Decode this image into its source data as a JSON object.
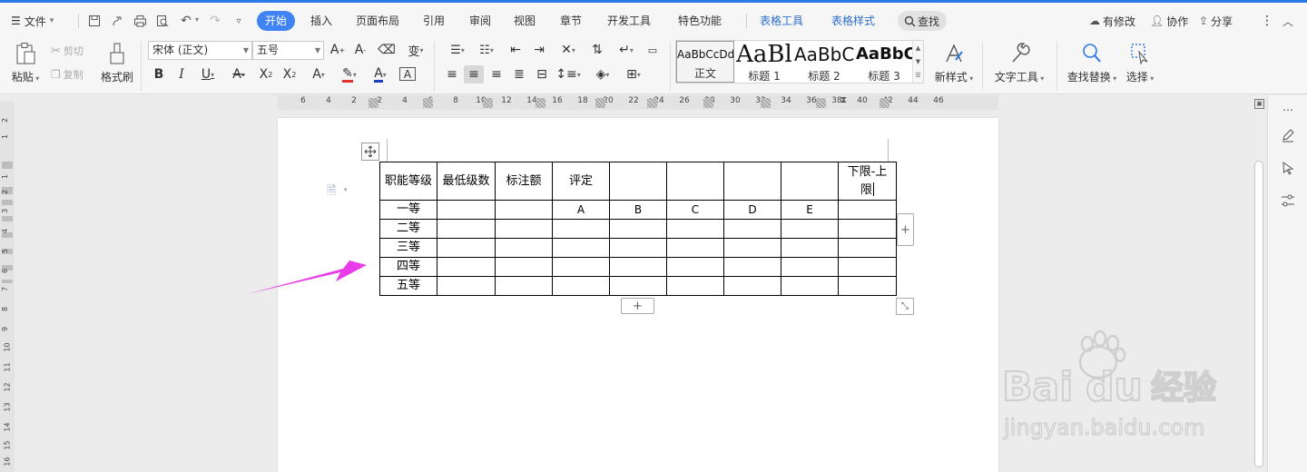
{
  "menubar": {
    "file_label": "文件",
    "tabs": [
      {
        "label": "开始",
        "active": true
      },
      {
        "label": "插入"
      },
      {
        "label": "页面布局"
      },
      {
        "label": "引用"
      },
      {
        "label": "审阅"
      },
      {
        "label": "视图"
      },
      {
        "label": "章节"
      },
      {
        "label": "开发工具"
      },
      {
        "label": "特色功能"
      },
      {
        "label": "表格工具",
        "contextual": true
      },
      {
        "label": "表格样式",
        "contextual": true
      }
    ],
    "search_label": "查找",
    "right_actions": {
      "modified": "有修改",
      "collab": "协作",
      "share": "分享"
    },
    "accent_color": "#3f83f5"
  },
  "ribbon": {
    "paste": "粘贴",
    "cut": "剪切",
    "copy": "复制",
    "format_painter": "格式刷",
    "font_name": "宋体 (正文)",
    "font_size": "五号",
    "styles": [
      {
        "preview": "AaBbCcDd",
        "caption": "正文"
      },
      {
        "preview": "AaBl",
        "caption": "标题 1"
      },
      {
        "preview": "AaBbC",
        "caption": "标题 2"
      },
      {
        "preview": "AaBbC(",
        "caption": "标题 3"
      }
    ],
    "new_style": "新样式",
    "text_tools": "文字工具",
    "find_replace": "查找替换",
    "select": "选择"
  },
  "ruler": {
    "h_numbers": [
      "6",
      "4",
      "2",
      "2",
      "4",
      "6",
      "8",
      "10",
      "12",
      "14",
      "16",
      "18",
      "20",
      "22",
      "24",
      "26",
      "28",
      "30",
      "32",
      "34",
      "36",
      "38",
      "40",
      "42",
      "44",
      "46"
    ],
    "v_numbers": [
      "2",
      "1",
      "1",
      "2",
      "3",
      "4",
      "5",
      "6",
      "7",
      "8",
      "9",
      "10",
      "11",
      "12",
      "13",
      "14",
      "15",
      "16"
    ]
  },
  "table": {
    "header": [
      "职能等级",
      "最低级数",
      "标注额",
      "评定",
      "",
      "",
      "",
      "",
      "下限-上限"
    ],
    "rows": [
      [
        "一等",
        "",
        "",
        "A",
        "B",
        "C",
        "D",
        "E",
        ""
      ],
      [
        "二等",
        "",
        "",
        "",
        "",
        "",
        "",
        "",
        ""
      ],
      [
        "三等",
        "",
        "",
        "",
        "",
        "",
        "",
        "",
        ""
      ],
      [
        "四等",
        "",
        "",
        "",
        "",
        "",
        "",
        "",
        ""
      ],
      [
        "五等",
        "",
        "",
        "",
        "",
        "",
        "",
        "",
        ""
      ]
    ]
  },
  "annotation": {
    "arrow_color": "#e83ce8"
  },
  "watermark": {
    "brand": "Bai du 经验",
    "url": "jingyan.baidu.com"
  }
}
